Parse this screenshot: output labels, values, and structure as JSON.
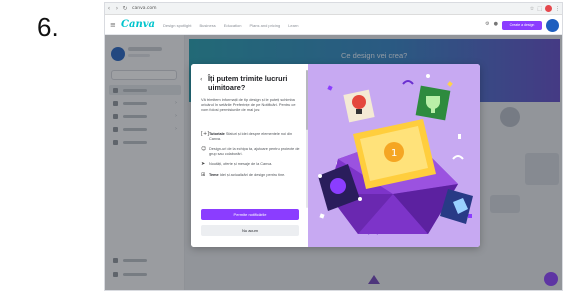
{
  "step_number": "6.",
  "browser": {
    "back": "‹",
    "forward": "›",
    "reload": "↻",
    "url": "canva.com",
    "profile_color": "#e5484d"
  },
  "header": {
    "logo": "Canva",
    "nav": [
      "Design spotlight",
      "Business",
      "Education",
      "Plans and pricing",
      "Learn"
    ],
    "cta_label": "Create a design",
    "brand_color": "#8b3dff",
    "logo_color": "#00c4cc"
  },
  "banner": {
    "title": "Ce design vei crea?"
  },
  "modal": {
    "back_icon": "‹",
    "title": "Îți putem trimite lucruri uimitoare?",
    "paragraph": "Vă trimitem informații de tip design și le puteți schimba oricând în setările Preferințe de pe Notificări. Pentru ce vom folosi permisiunile de mai jos:",
    "items": [
      {
        "icon": "[+]",
        "bold": "Tutoriale",
        "text": "Sfaturi și idei despre elementele noi din Canva."
      },
      {
        "icon": "☺",
        "bold": "",
        "text": "Design-uri de la echipa ta, ajutoare pentru proiecte de grup sau colaborări."
      },
      {
        "icon": "➤",
        "bold": "",
        "text": "Noutăți, oferte și mesaje de la Canva."
      },
      {
        "icon": "⊞",
        "bold": "Teme",
        "text": "Idei și actualizări de design pentru tine."
      }
    ],
    "primary_button": "Permite notificările",
    "secondary_button": "Nu acum",
    "illustration_bg": "#c7a9f2"
  }
}
